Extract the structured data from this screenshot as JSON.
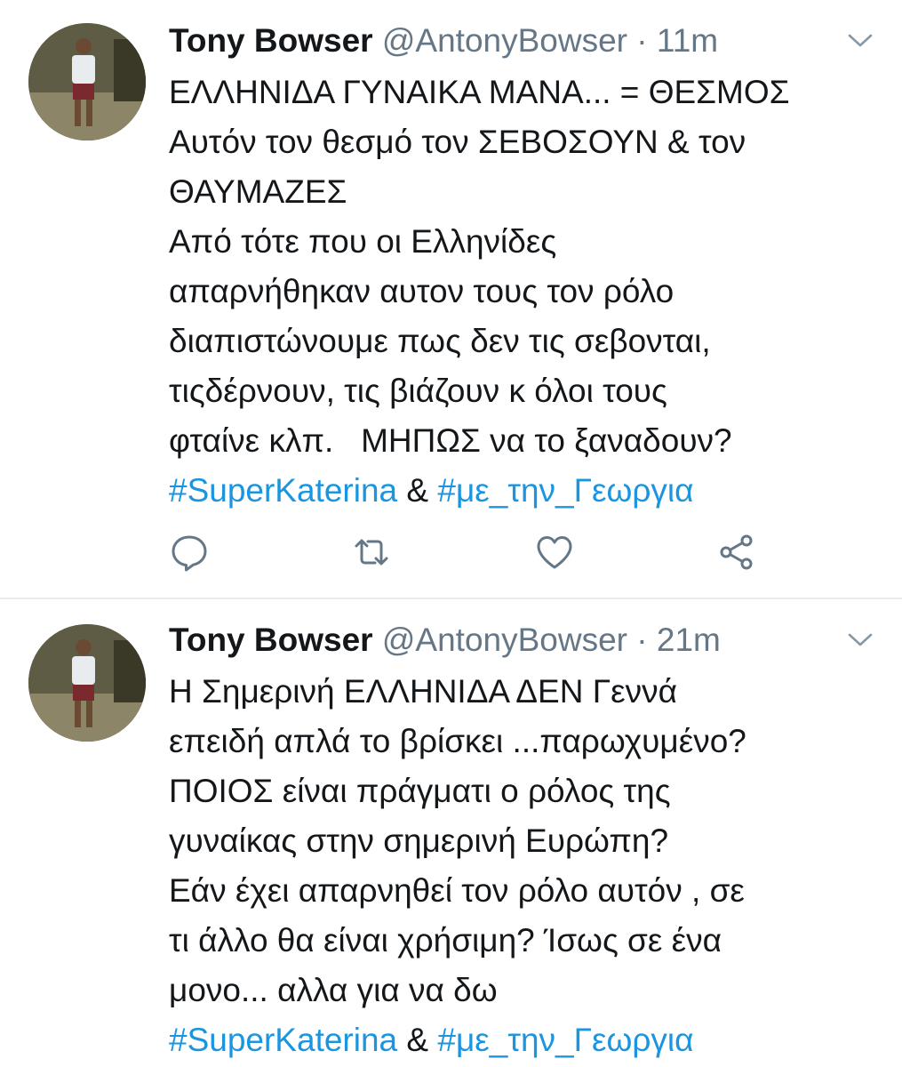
{
  "tweets": [
    {
      "author_name": "Tony Bowser",
      "handle": "@AntonyBowser",
      "separator": "·",
      "time": "11m",
      "lines": [
        "ΕΛΛΗΝΙΔΑ ΓΥΝΑΙΚΑ ΜΑΝΑ... = ΘΕΣΜΟΣ",
        "Αυτόν τον θεσμό τον ΣΕΒΟΣΟΥΝ & τον",
        "ΘΑΥΜΑΖΕΣ",
        "Από τότε που οι Ελληνίδες",
        "απαρνήθηκαν αυτον τους τον ρόλο",
        "διαπιστώνουμε πως δεν τις σεβονται,",
        "τιςδέρνουν, τις βιάζουν κ όλοι τους",
        "φταίνε κλπ.   ΜΗΠΩΣ να το ξαναδουν?"
      ],
      "hashtag1": "#SuperKaterina",
      "amp": " & ",
      "hashtag2": "#με_την_Γεωργια",
      "icons": [
        "reply-icon",
        "retweet-icon",
        "like-icon",
        "share-icon"
      ]
    },
    {
      "author_name": "Tony Bowser",
      "handle": "@AntonyBowser",
      "separator": "·",
      "time": "21m",
      "lines": [
        "Η Σημερινή ΕΛΛΗΝΙΔΑ ΔΕΝ Γεννά",
        "επειδή απλά το βρίσκει ...παρωχυμένο?",
        "ΠΟΙΟΣ είναι πράγματι ο ρόλος της",
        "γυναίκας στην σημερινή Ευρώπη?",
        "Εάν έχει απαρνηθεί τον ρόλο αυτόν , σε",
        "τι άλλο θα είναι χρήσιμη? Ίσως σε ένα",
        "μονο... αλλα για να δω"
      ],
      "hashtag1": "#SuperKaterina",
      "amp": " & ",
      "hashtag2": "#με_την_Γεωργια"
    }
  ],
  "colors": {
    "text": "#14171a",
    "secondary": "#657786",
    "hashtag": "#1b95e0",
    "divider": "#e6ecf0"
  }
}
